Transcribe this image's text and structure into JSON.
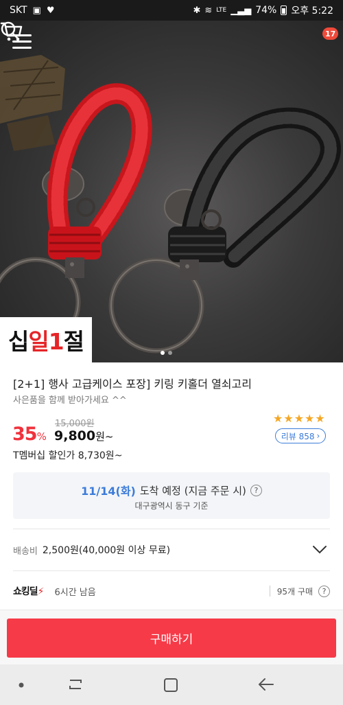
{
  "status_bar": {
    "carrier": "SKT",
    "network": "LTE",
    "battery": "74%",
    "time": "오후 5:22"
  },
  "header": {
    "cart_count": "17"
  },
  "hero": {
    "brand_logo_prefix": "십",
    "brand_logo_mid": "일1",
    "brand_logo_suffix": "절",
    "carousel_total": 2,
    "carousel_active": 1
  },
  "product": {
    "title": "[2+1] 행사 고급케이스 포장] 키링 키홀더 열쇠고리",
    "subtitle": "사은품을 함께 받아가세요 ^^",
    "original_price": "15,000원",
    "discount_rate": "35",
    "discount_unit": "%",
    "sale_price": "9,800",
    "sale_price_unit": "원~",
    "rating_stars": "★★★★★",
    "rating": 4.5,
    "review_label": "리뷰 858",
    "member_price": "T멤버십 할인가 8,730원~"
  },
  "delivery": {
    "date": "11/14(화)",
    "text": "도착 예정 (지금 주문 시)",
    "help": "?",
    "location": "대구광역시 동구 기준"
  },
  "shipping": {
    "label": "배송비",
    "value": "2,500원(40,000원 이상 무료)"
  },
  "deal": {
    "logo_text": "쇼킹딜",
    "time_left": "6시간 남음",
    "purchase_count": "95개 구매",
    "help": "?"
  },
  "buy_button": {
    "label": "구매하기"
  },
  "colors": {
    "accent_red": "#f63a48",
    "link_blue": "#3b7bd9",
    "star_gold": "#f5a623"
  }
}
